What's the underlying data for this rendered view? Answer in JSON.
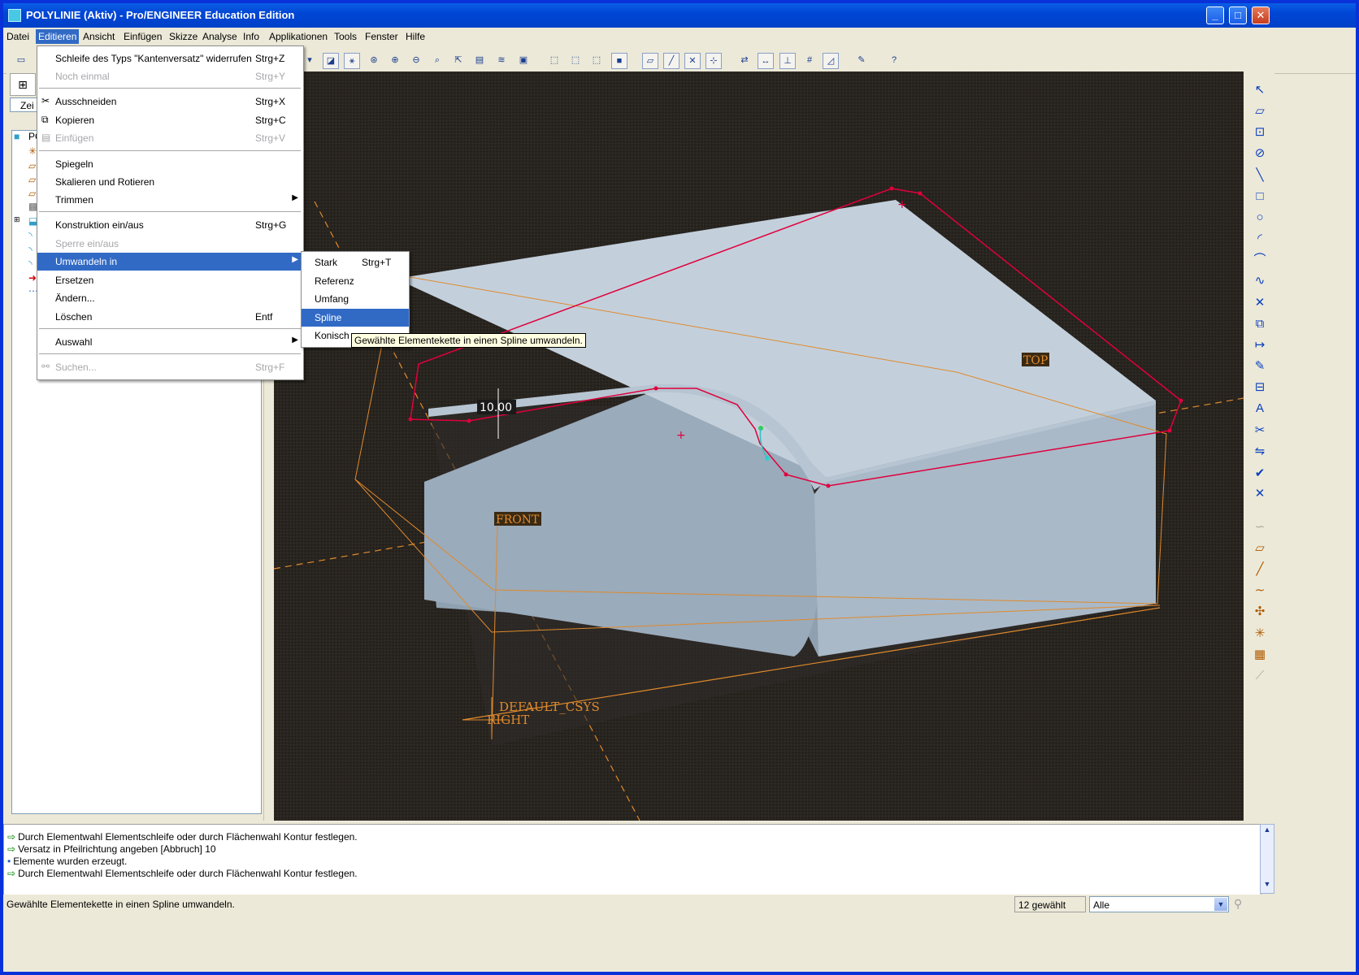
{
  "window": {
    "title": "POLYLINIE (Aktiv) - Pro/ENGINEER Education Edition"
  },
  "menubar": [
    "Datei",
    "Editieren",
    "Ansicht",
    "Einfügen",
    "Skizze",
    "Analyse",
    "Info",
    "Applikationen",
    "Tools",
    "Fenster",
    "Hilfe"
  ],
  "edit_menu": [
    {
      "label": "Schleife des Typs \"Kantenversatz\" widerrufen",
      "shortcut": "Strg+Z"
    },
    {
      "label": "Noch einmal",
      "shortcut": "Strg+Y"
    },
    {
      "label": "Ausschneiden",
      "shortcut": "Strg+X"
    },
    {
      "label": "Kopieren",
      "shortcut": "Strg+C"
    },
    {
      "label": "Einfügen",
      "shortcut": "Strg+V"
    },
    {
      "label": "Spiegeln",
      "shortcut": ""
    },
    {
      "label": "Skalieren und Rotieren",
      "shortcut": ""
    },
    {
      "label": "Trimmen",
      "shortcut": ""
    },
    {
      "label": "Konstruktion ein/aus",
      "shortcut": "Strg+G"
    },
    {
      "label": "Sperre ein/aus",
      "shortcut": ""
    },
    {
      "label": "Umwandeln in",
      "shortcut": ""
    },
    {
      "label": "Ersetzen",
      "shortcut": ""
    },
    {
      "label": "Ändern...",
      "shortcut": ""
    },
    {
      "label": "Löschen",
      "shortcut": "Entf"
    },
    {
      "label": "Auswahl",
      "shortcut": ""
    },
    {
      "label": "Suchen...",
      "shortcut": "Strg+F"
    }
  ],
  "convert_menu": [
    {
      "label": "Stark",
      "shortcut": "Strg+T"
    },
    {
      "label": "Referenz",
      "shortcut": ""
    },
    {
      "label": "Umfang",
      "shortcut": ""
    },
    {
      "label": "Spline",
      "shortcut": ""
    },
    {
      "label": "Konisch",
      "shortcut": ""
    }
  ],
  "tooltip": "Gewählte Elementekette in einen Spline umwandeln.",
  "left_panel": {
    "tab_label": "Zei",
    "tree_root": "PO"
  },
  "viewport": {
    "dimension": "10.00",
    "datum_top": "TOP",
    "datum_front": "FRONT",
    "csys": "DEFAULT_CSYS",
    "datum_right": "RIGHT"
  },
  "messages": [
    {
      "icon": "arrow",
      "text": "Durch Elementwahl Elementschleife oder durch Flächenwahl Kontur festlegen."
    },
    {
      "icon": "arrow",
      "text": "Versatz in Pfeilrichtung angeben [Abbruch]   10"
    },
    {
      "icon": "dot",
      "text": "Elemente wurden erzeugt."
    },
    {
      "icon": "arrow",
      "text": "Durch Elementwahl Elementschleife oder durch Flächenwahl Kontur festlegen."
    }
  ],
  "status": {
    "text": "Gewählte Elementekette in einen Spline umwandeln.",
    "selection_count": "12 gewählt",
    "filter": "Alle"
  },
  "colors": {
    "accent": "#316ac5",
    "titlebar": "#0046d5",
    "viewport_bg": "#27231f",
    "model": "#aebdcd",
    "sketch": "#e0003c",
    "datum": "#e08a2c"
  }
}
